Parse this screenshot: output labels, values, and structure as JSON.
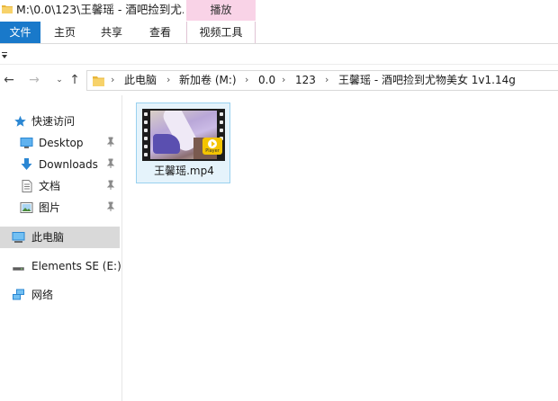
{
  "window": {
    "title": "M:\\0.0\\123\\王馨瑶 - 酒吧捡到尤..."
  },
  "ribbon": {
    "context_group": "播放",
    "tabs": [
      {
        "label": "文件",
        "active": true
      },
      {
        "label": "主页"
      },
      {
        "label": "共享"
      },
      {
        "label": "查看"
      },
      {
        "label": "视频工具"
      }
    ]
  },
  "address": {
    "breadcrumbs": [
      "此电脑",
      "新加卷 (M:)",
      "0.0",
      "123",
      "王馨瑶 - 酒吧捡到尤物美女 1v1.14g"
    ]
  },
  "sidebar": {
    "items": [
      {
        "label": "快速访问",
        "icon": "star-icon"
      },
      {
        "label": "Desktop",
        "icon": "desktop-icon",
        "pinned": true
      },
      {
        "label": "Downloads",
        "icon": "download-arrow-icon",
        "pinned": true
      },
      {
        "label": "文档",
        "icon": "document-icon",
        "pinned": true
      },
      {
        "label": "图片",
        "icon": "pictures-icon",
        "pinned": true
      },
      {
        "label": "此电脑",
        "icon": "computer-icon",
        "selected": true
      },
      {
        "label": "Elements SE (E:)",
        "icon": "drive-icon"
      },
      {
        "label": "网络",
        "icon": "network-icon"
      }
    ]
  },
  "content": {
    "files": [
      {
        "name": "王馨瑶.mp4",
        "type": "video",
        "badge": "Player"
      }
    ]
  },
  "colors": {
    "file_tab": "#1979ca",
    "context_tab": "#f9d3e7",
    "selection": "#e5f3fb",
    "selection_border": "#99d1ef"
  }
}
